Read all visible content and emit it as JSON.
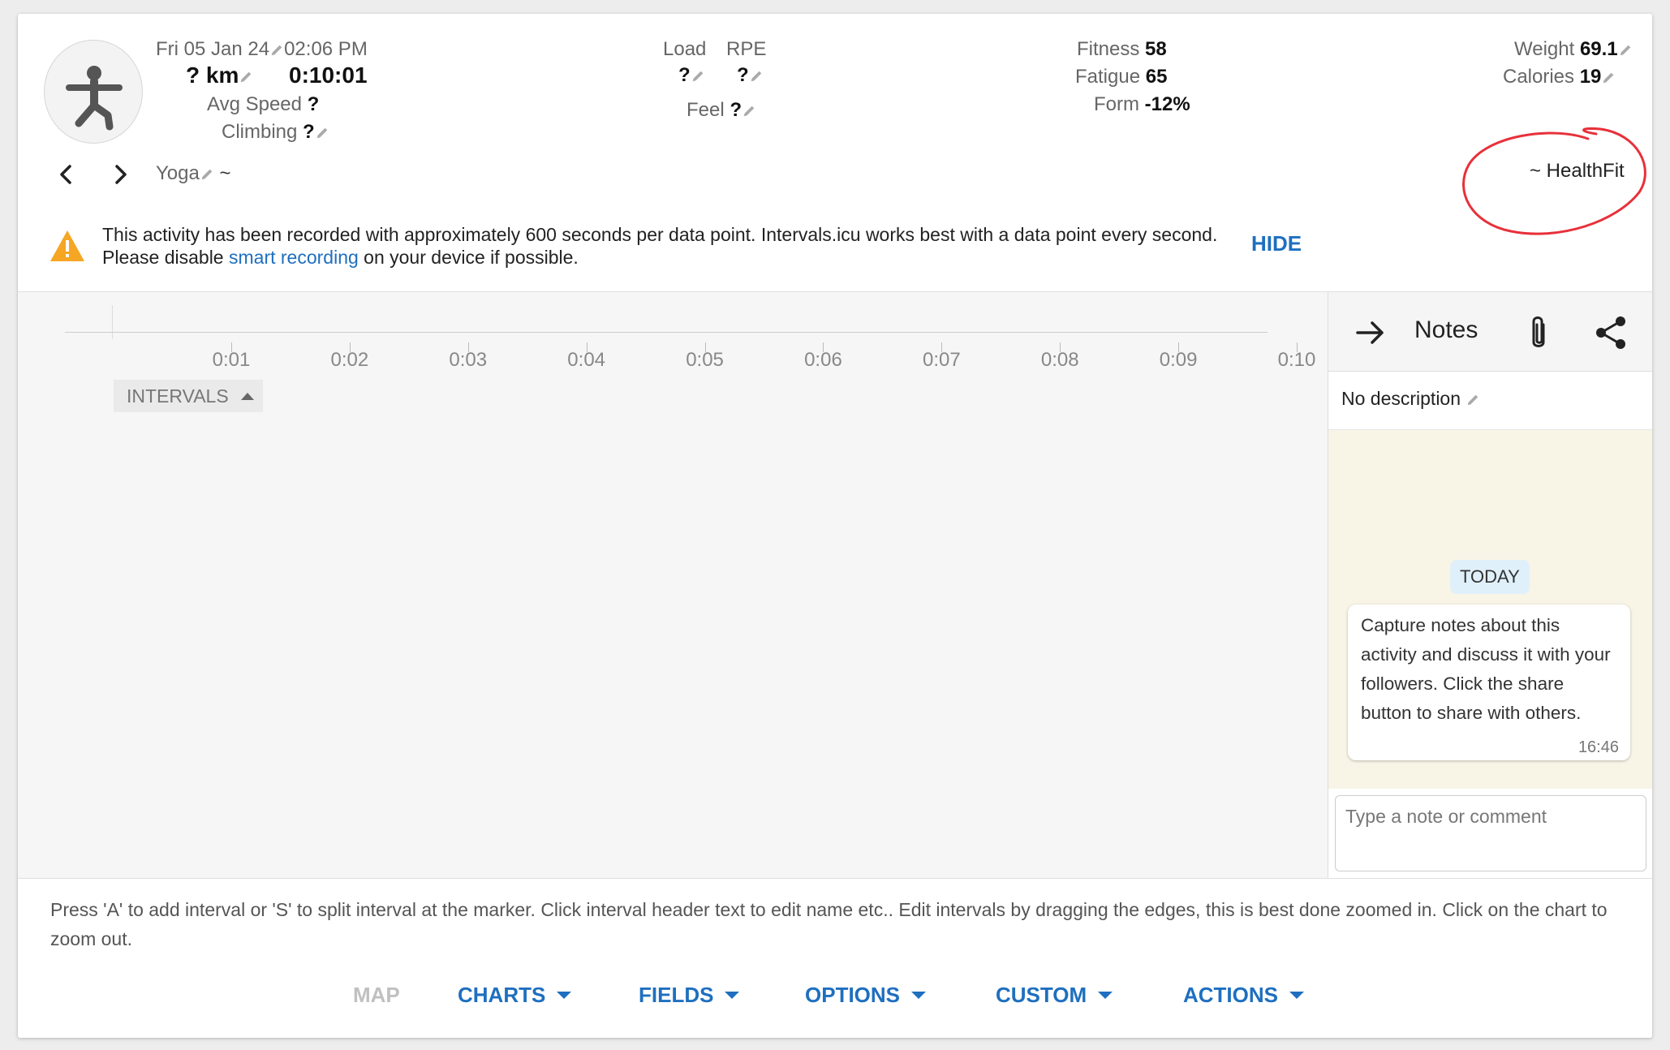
{
  "activity": {
    "date": "Fri 05 Jan 24",
    "time": "02:06 PM",
    "distance": "? km",
    "duration": "0:10:01",
    "avg_speed_label": "Avg Speed",
    "avg_speed_value": "?",
    "climbing_label": "Climbing",
    "climbing_value": "?",
    "type": "Yoga",
    "type_suffix": "~",
    "source": "~ HealthFit",
    "icon": "yoga-person-icon"
  },
  "metrics": {
    "load_label": "Load",
    "load_value": "?",
    "rpe_label": "RPE",
    "rpe_value": "?",
    "feel_label": "Feel",
    "feel_value": "?",
    "fitness_label": "Fitness",
    "fitness_value": "58",
    "fatigue_label": "Fatigue",
    "fatigue_value": "65",
    "form_label": "Form",
    "form_value": "-12%",
    "weight_label": "Weight",
    "weight_value": "69.1",
    "calories_label": "Calories",
    "calories_value": "19"
  },
  "warning": {
    "text_before": "This activity has been recorded with approximately 600 seconds per data point. Intervals.icu works best with a data point every second. Please disable ",
    "link": "smart recording",
    "text_after": " on your device if possible.",
    "hide_label": "HIDE",
    "color": "#f5a623"
  },
  "chart": {
    "ticks": [
      "0:01",
      "0:02",
      "0:03",
      "0:04",
      "0:05",
      "0:06",
      "0:07",
      "0:08",
      "0:09",
      "0:10"
    ],
    "intervals_label": "INTERVALS"
  },
  "notes": {
    "title": "Notes",
    "description": "No description",
    "today_label": "TODAY",
    "message": "Capture notes about this activity and discuss it with your followers. Click the share button to share with others.",
    "message_time": "16:46",
    "input_placeholder": "Type a note or comment"
  },
  "footer": {
    "help": "Press 'A' to add interval or 'S' to split interval at the marker. Click interval header text to edit name etc.. Edit intervals by dragging the edges, this is best done zoomed in. Click on the chart to zoom out.",
    "tabs": [
      "MAP",
      "CHARTS",
      "FIELDS",
      "OPTIONS",
      "CUSTOM",
      "ACTIONS"
    ]
  },
  "colors": {
    "accent": "#1e6fbf",
    "annotation": "#e8303a"
  }
}
